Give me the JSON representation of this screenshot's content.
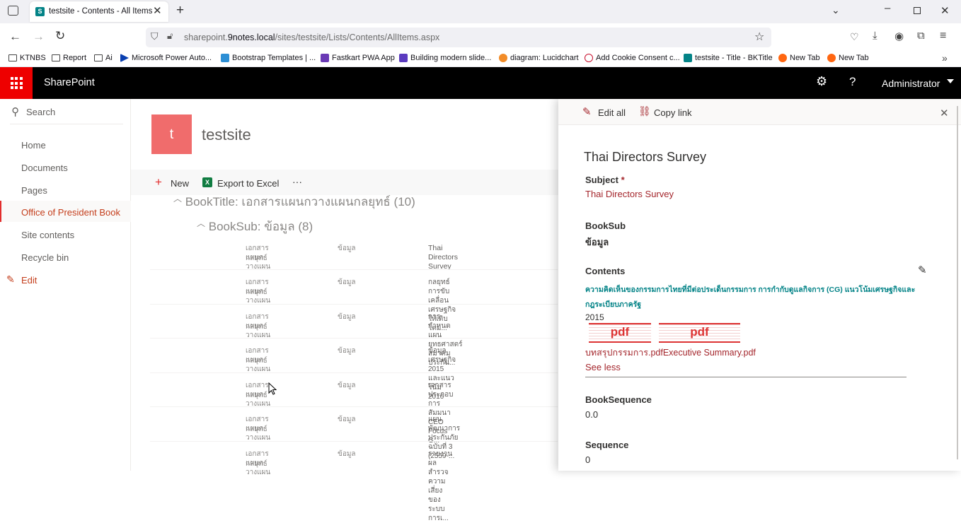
{
  "browser": {
    "tab_title": "testsite - Contents - All Items",
    "url_host": "sharepoint.",
    "url_domain": "9notes.local",
    "url_path": "/sites/testsite/Lists/Contents/AllItems.aspx",
    "bookmarks": [
      "KTNBS",
      "Report",
      "Ai",
      "Microsoft Power Auto...",
      "Bootstrap Templates | ...",
      "Fastkart PWA App",
      "Building modern slide...",
      "diagram: Lucidchart",
      "Add Cookie Consent c...",
      "testsite - Title - BKTitle",
      "New Tab",
      "New Tab"
    ]
  },
  "suite": {
    "app_name": "SharePoint",
    "user": "Administrator",
    "help": "?"
  },
  "site": {
    "logo_letter": "t",
    "name": "testsite"
  },
  "leftnav": {
    "search": "Search",
    "items": [
      "Home",
      "Documents",
      "Pages",
      "Office of President Book",
      "Site contents",
      "Recycle bin"
    ],
    "edit": "Edit"
  },
  "commandbar": {
    "new": "New",
    "export": "Export to Excel",
    "more": "···"
  },
  "groups": {
    "booktitle": "BookTitle: เอกสารแผนกวางแผนกลยุทธ์ (10)",
    "booksub": "BookSub: ข้อมูล (8)"
  },
  "rows": [
    {
      "c1a": "เอกสารแผนกวางแผน",
      "c1b": "กลยุทธ์",
      "c2": "ข้อมูล",
      "c3": "Thai Directors Survey"
    },
    {
      "c1a": "เอกสารแผนกวางแผน",
      "c1b": "กลยุทธ์",
      "c2": "ข้อมูล",
      "c3": "กลยุทธ์การขับเคลื่อนเศรษฐกิจให้เติบโตม..."
    },
    {
      "c1a": "เอกสารแผนกวางแผน",
      "c1b": "กลยุทธ์",
      "c2": "ข้อมูล",
      "c3": "การกำหนดแผนยุทธศาสตร์สมาคมประกัน..."
    },
    {
      "c1a": "เอกสารแผนกวางแผน",
      "c1b": "กลยุทธ์",
      "c2": "ข้อมูล",
      "c3": "ข้อมูลเศรษฐกิจ 2015 และแนวโน้ม 2016"
    },
    {
      "c1a": "เอกสารแผนกวางแผน",
      "c1b": "กลยุทธ์",
      "c2": "ข้อมูล",
      "c3": "เอกสารประกอบการสัมมนา CEO Focus G..."
    },
    {
      "c1a": "เอกสารแผนกวางแผน",
      "c1b": "กลยุทธ์",
      "c2": "ข้อมูล",
      "c3": "แผนพัฒนาการประกันภัย ฉบับที่ 3 (2559-..."
    },
    {
      "c1a": "เอกสารแผนกวางแผน",
      "c1b": "กลยุทธ์",
      "c2": "ข้อมูล",
      "c3": "รายงานผลสำรวจความเสี่ยงของระบบการเ..."
    }
  ],
  "panel": {
    "edit_all": "Edit all",
    "copy_link": "Copy link",
    "title": "Thai Directors Survey",
    "subject_label": "Subject",
    "required": "*",
    "subject_value": "Thai Directors Survey",
    "booksub_label": "BookSub",
    "booksub_value": "ข้อมูล",
    "contents_label": "Contents",
    "contents_line1": "ความคิดเห็นของกรรมการไทยที่มีต่อประเด็นกรรมการ การกำกับดูแลกิจการ (CG) แนวโน้มเศรษฐกิจและ",
    "contents_line2": "กฎระเบียบภาครัฐ",
    "contents_year": "2015",
    "pdf_icon_text": "pdf",
    "file_links": "บทสรุปกรรมการ.pdfExecutive Summary.pdf",
    "see_less": "See less",
    "bookseq_label": "BookSequence",
    "bookseq_value": "0.0",
    "seq_label": "Sequence",
    "seq_value": "0"
  },
  "colors": {
    "accent": "#e22d2d",
    "suite": "#000000",
    "waffle": "#ee0000",
    "link": "#a4262c",
    "teal": "#038387"
  }
}
